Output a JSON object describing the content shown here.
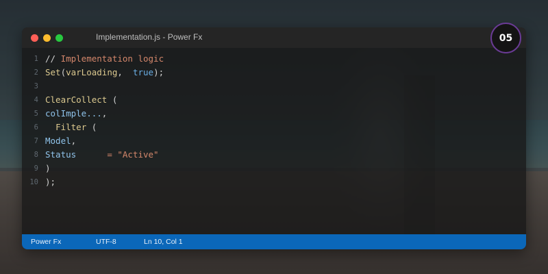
{
  "window": {
    "title": "Implementation.js - Power Fx"
  },
  "traffic_lights": [
    {
      "name": "close-dot",
      "color": "#ff5f57"
    },
    {
      "name": "minimize-dot",
      "color": "#febc2e"
    },
    {
      "name": "maximize-dot",
      "color": "#28c840"
    }
  ],
  "colors": {
    "comment": "#d4876b",
    "function": "#dcc98f",
    "identifier": "#8fc3ea",
    "keyword": "#6aaee4",
    "operator": "#d4876b",
    "string": "#d4876b",
    "punctuation": "#d2d2d2",
    "line_number": "#5f6870",
    "status_bar": "#0b67b9",
    "badge_border": "#6a3b95"
  },
  "code_lines": [
    {
      "number": "1",
      "tokens": [
        {
          "text": "// ",
          "role": "punctuation"
        },
        {
          "text": "Implementation logic",
          "role": "comment"
        }
      ]
    },
    {
      "number": "2",
      "tokens": [
        {
          "text": "Set",
          "role": "function"
        },
        {
          "text": "(",
          "role": "punctuation"
        },
        {
          "text": "varLoading",
          "role": "function"
        },
        {
          "text": ",  ",
          "role": "punctuation"
        },
        {
          "text": "true",
          "role": "keyword"
        },
        {
          "text": ");",
          "role": "punctuation"
        }
      ]
    },
    {
      "number": "3",
      "tokens": []
    },
    {
      "number": "4",
      "tokens": [
        {
          "text": "ClearCollect",
          "role": "function"
        },
        {
          "text": " (",
          "role": "punctuation"
        }
      ]
    },
    {
      "number": "5",
      "tokens": [
        {
          "text": "colImple...",
          "role": "identifier"
        },
        {
          "text": ",",
          "role": "punctuation"
        }
      ]
    },
    {
      "number": "6",
      "tokens": [
        {
          "text": "  ",
          "role": "punctuation"
        },
        {
          "text": "Filter",
          "role": "function"
        },
        {
          "text": " (",
          "role": "punctuation"
        }
      ]
    },
    {
      "number": "7",
      "tokens": [
        {
          "text": "Model",
          "role": "identifier"
        },
        {
          "text": ",",
          "role": "punctuation"
        }
      ]
    },
    {
      "number": "8",
      "tokens": [
        {
          "text": "Status",
          "role": "identifier"
        },
        {
          "text": "      ",
          "role": "punctuation"
        },
        {
          "text": "= ",
          "role": "operator"
        },
        {
          "text": "\"Active\"",
          "role": "string"
        }
      ]
    },
    {
      "number": "9",
      "tokens": [
        {
          "text": ")",
          "role": "punctuation"
        }
      ]
    },
    {
      "number": "10",
      "tokens": [
        {
          "text": ");",
          "role": "punctuation"
        }
      ]
    }
  ],
  "status_bar": {
    "language": "Power Fx",
    "encoding": "UTF-8",
    "cursor": "Ln 10, Col 1"
  },
  "step_badge": "05"
}
